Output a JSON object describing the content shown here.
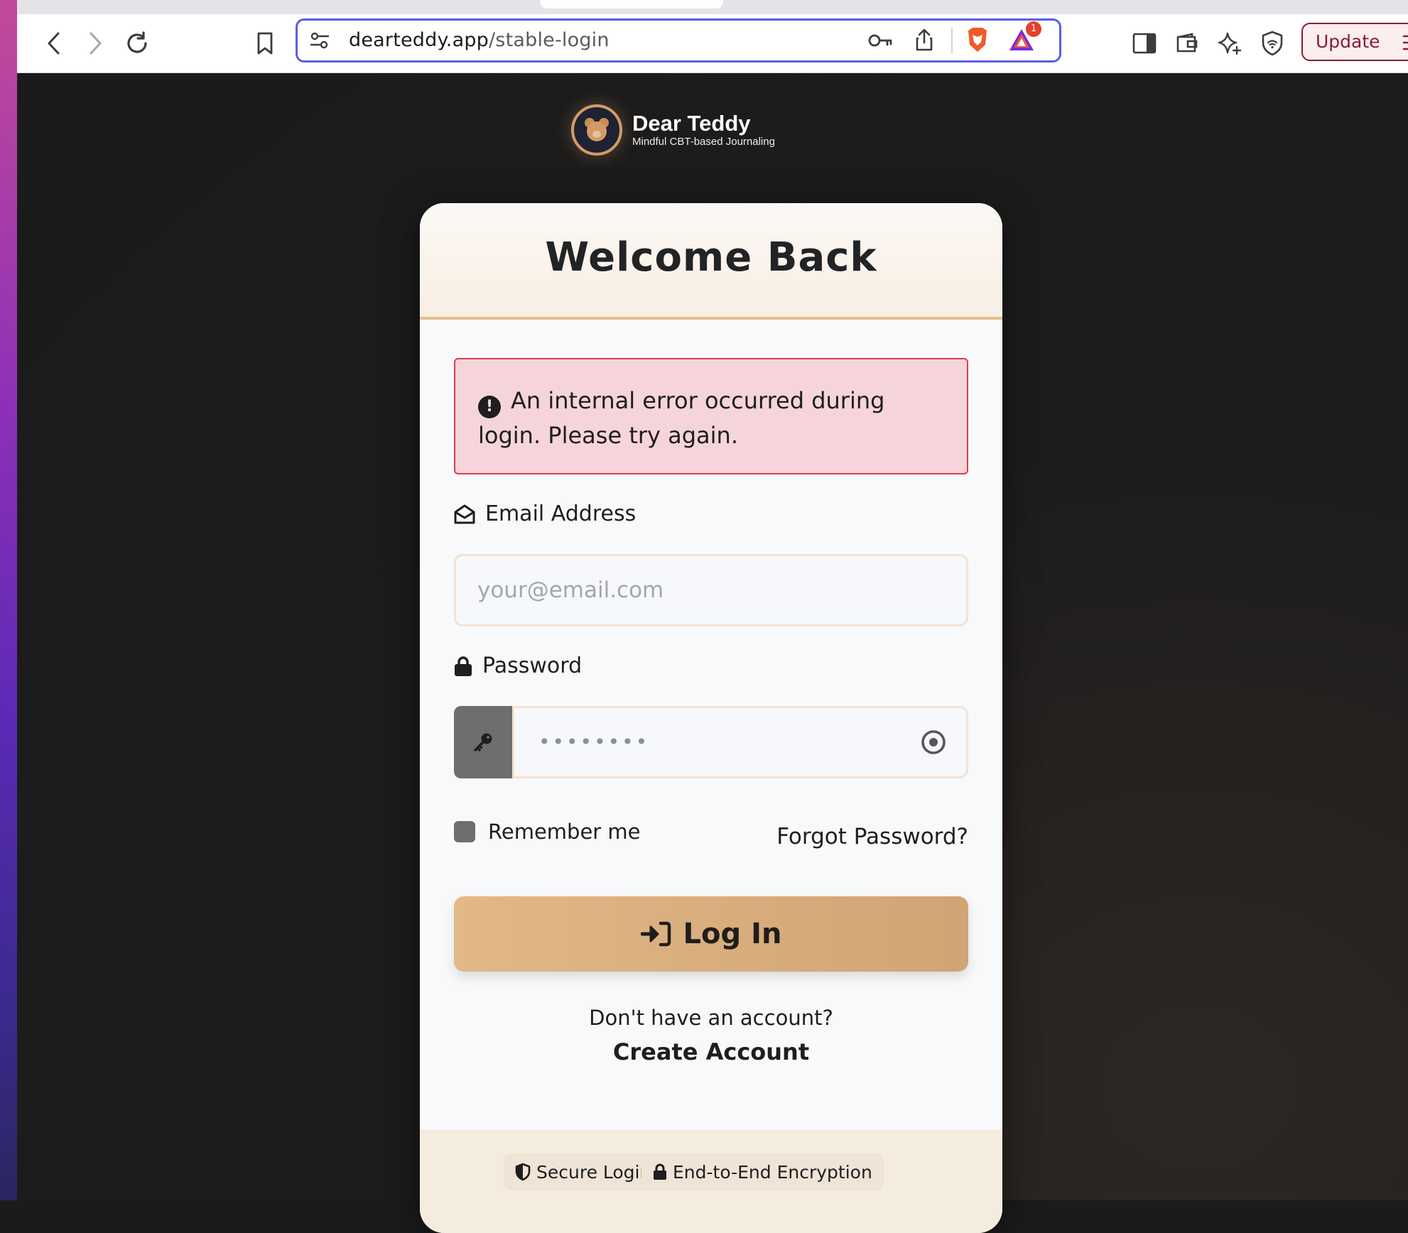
{
  "browser": {
    "url_domain": "dearteddy.app",
    "url_path": "/stable-login",
    "notification_count": "1",
    "update_label": "Update"
  },
  "brand": {
    "name": "Dear Teddy",
    "tagline": "Mindful CBT-based Journaling"
  },
  "login": {
    "title": "Welcome Back",
    "error_message": "An internal error occurred during login. Please try again.",
    "email_label": "Email Address",
    "email_placeholder": "your@email.com",
    "password_label": "Password",
    "password_placeholder": "••••••••",
    "remember_label": "Remember me",
    "forgot_label": "Forgot Password?",
    "submit_label": "Log In",
    "signup_prompt": "Don't have an account?",
    "signup_link": "Create Account"
  },
  "footer": {
    "badges": [
      "Secure Login",
      "End-to-End Encryption"
    ]
  },
  "colors": {
    "accent": "#d9ab7a",
    "error_border": "#e0394f",
    "error_bg": "#f6d5da",
    "url_focus": "#5b5ee0"
  }
}
